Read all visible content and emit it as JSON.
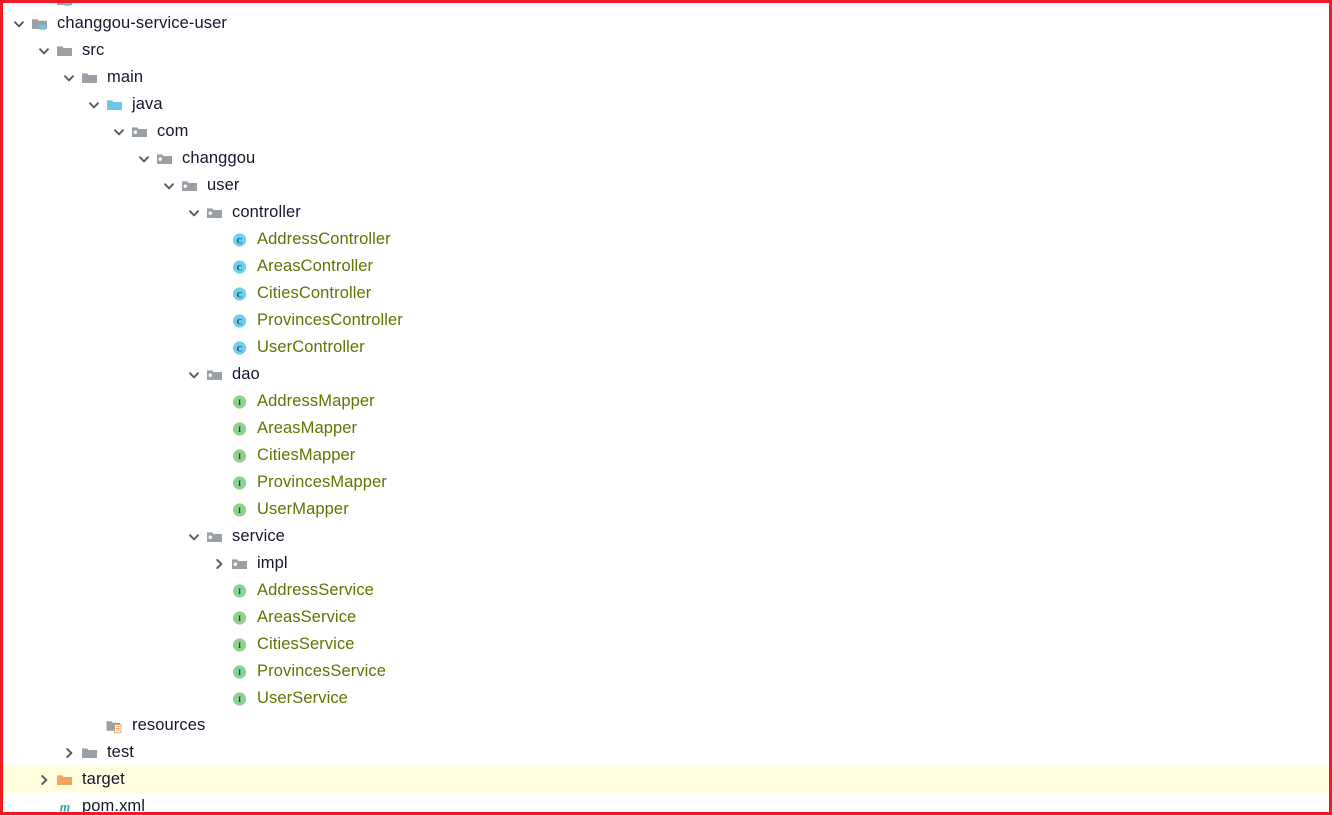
{
  "window": {
    "type": "project-tree",
    "border_color": "#ED1C24",
    "background": "#ffffff",
    "highlight_color": "#FFFFE0"
  },
  "colors": {
    "folder_grey": "#9aa0a6",
    "folder_cyan": "#6cc6e8",
    "folder_orange": "#F2A35E",
    "class_icon": "#6fd0ee",
    "interface_icon": "#8fd18f",
    "class_text": "#5c7600",
    "folder_text": "#15172b",
    "maven_icon": "#2fa9a5",
    "chevron": "#5a5a5a"
  },
  "tree": {
    "items": [
      {
        "id": "clipped-root",
        "label": "",
        "indent": 1,
        "icon": "module-folder-icon",
        "state": "clipped",
        "twisty": "none",
        "highlight": false,
        "clipped": true
      },
      {
        "id": "changgou-service-user",
        "label": "changgou-service-user",
        "indent": 0,
        "icon": "module-folder-icon",
        "state": "expanded",
        "twisty": "down",
        "highlight": false
      },
      {
        "id": "src",
        "label": "src",
        "indent": 1,
        "icon": "folder-icon",
        "state": "expanded",
        "twisty": "down",
        "highlight": false
      },
      {
        "id": "main",
        "label": "main",
        "indent": 2,
        "icon": "folder-icon",
        "state": "expanded",
        "twisty": "down",
        "highlight": false
      },
      {
        "id": "java",
        "label": "java",
        "indent": 3,
        "icon": "source-root-folder-icon",
        "state": "expanded",
        "twisty": "down",
        "highlight": false
      },
      {
        "id": "com",
        "label": "com",
        "indent": 4,
        "icon": "package-folder-icon",
        "state": "expanded",
        "twisty": "down",
        "highlight": false
      },
      {
        "id": "changgou",
        "label": "changgou",
        "indent": 5,
        "icon": "package-folder-icon",
        "state": "expanded",
        "twisty": "down",
        "highlight": false
      },
      {
        "id": "user",
        "label": "user",
        "indent": 6,
        "icon": "package-folder-icon",
        "state": "expanded",
        "twisty": "down",
        "highlight": false
      },
      {
        "id": "controller",
        "label": "controller",
        "indent": 7,
        "icon": "package-folder-icon",
        "state": "expanded",
        "twisty": "down",
        "highlight": false
      },
      {
        "id": "AddressController",
        "label": "AddressController",
        "indent": 8,
        "icon": "java-class-icon",
        "state": "leaf",
        "twisty": "none",
        "highlight": false,
        "text_style": "src-green"
      },
      {
        "id": "AreasController",
        "label": "AreasController",
        "indent": 8,
        "icon": "java-class-icon",
        "state": "leaf",
        "twisty": "none",
        "highlight": false,
        "text_style": "src-green"
      },
      {
        "id": "CitiesController",
        "label": "CitiesController",
        "indent": 8,
        "icon": "java-class-icon",
        "state": "leaf",
        "twisty": "none",
        "highlight": false,
        "text_style": "src-green"
      },
      {
        "id": "ProvincesController",
        "label": "ProvincesController",
        "indent": 8,
        "icon": "java-class-icon",
        "state": "leaf",
        "twisty": "none",
        "highlight": false,
        "text_style": "src-green"
      },
      {
        "id": "UserController",
        "label": "UserController",
        "indent": 8,
        "icon": "java-class-icon",
        "state": "leaf",
        "twisty": "none",
        "highlight": false,
        "text_style": "src-green"
      },
      {
        "id": "dao",
        "label": "dao",
        "indent": 7,
        "icon": "package-folder-icon",
        "state": "expanded",
        "twisty": "down",
        "highlight": false
      },
      {
        "id": "AddressMapper",
        "label": "AddressMapper",
        "indent": 8,
        "icon": "java-interface-icon",
        "state": "leaf",
        "twisty": "none",
        "highlight": false,
        "text_style": "src-green"
      },
      {
        "id": "AreasMapper",
        "label": "AreasMapper",
        "indent": 8,
        "icon": "java-interface-icon",
        "state": "leaf",
        "twisty": "none",
        "highlight": false,
        "text_style": "src-green"
      },
      {
        "id": "CitiesMapper",
        "label": "CitiesMapper",
        "indent": 8,
        "icon": "java-interface-icon",
        "state": "leaf",
        "twisty": "none",
        "highlight": false,
        "text_style": "src-green"
      },
      {
        "id": "ProvincesMapper",
        "label": "ProvincesMapper",
        "indent": 8,
        "icon": "java-interface-icon",
        "state": "leaf",
        "twisty": "none",
        "highlight": false,
        "text_style": "src-green"
      },
      {
        "id": "UserMapper",
        "label": "UserMapper",
        "indent": 8,
        "icon": "java-interface-icon",
        "state": "leaf",
        "twisty": "none",
        "highlight": false,
        "text_style": "src-green"
      },
      {
        "id": "service",
        "label": "service",
        "indent": 7,
        "icon": "package-folder-icon",
        "state": "expanded",
        "twisty": "down",
        "highlight": false
      },
      {
        "id": "impl",
        "label": "impl",
        "indent": 8,
        "icon": "package-folder-icon",
        "state": "collapsed",
        "twisty": "right",
        "highlight": false
      },
      {
        "id": "AddressService",
        "label": "AddressService",
        "indent": 8,
        "icon": "java-interface-icon",
        "state": "leaf",
        "twisty": "none",
        "highlight": false,
        "text_style": "src-green"
      },
      {
        "id": "AreasService",
        "label": "AreasService",
        "indent": 8,
        "icon": "java-interface-icon",
        "state": "leaf",
        "twisty": "none",
        "highlight": false,
        "text_style": "src-green"
      },
      {
        "id": "CitiesService",
        "label": "CitiesService",
        "indent": 8,
        "icon": "java-interface-icon",
        "state": "leaf",
        "twisty": "none",
        "highlight": false,
        "text_style": "src-green"
      },
      {
        "id": "ProvincesService",
        "label": "ProvincesService",
        "indent": 8,
        "icon": "java-interface-icon",
        "state": "leaf",
        "twisty": "none",
        "highlight": false,
        "text_style": "src-green"
      },
      {
        "id": "UserService",
        "label": "UserService",
        "indent": 8,
        "icon": "java-interface-icon",
        "state": "leaf",
        "twisty": "none",
        "highlight": false,
        "text_style": "src-green"
      },
      {
        "id": "resources",
        "label": "resources",
        "indent": 3,
        "icon": "resources-folder-icon",
        "state": "leaf",
        "twisty": "none",
        "highlight": false
      },
      {
        "id": "test",
        "label": "test",
        "indent": 2,
        "icon": "folder-icon",
        "state": "collapsed",
        "twisty": "right",
        "highlight": false
      },
      {
        "id": "target",
        "label": "target",
        "indent": 1,
        "icon": "excluded-folder-icon",
        "state": "collapsed",
        "twisty": "right",
        "highlight": true
      },
      {
        "id": "pom.xml",
        "label": "pom.xml",
        "indent": 1,
        "icon": "maven-pom-icon",
        "state": "leaf",
        "twisty": "none",
        "highlight": false
      }
    ]
  }
}
